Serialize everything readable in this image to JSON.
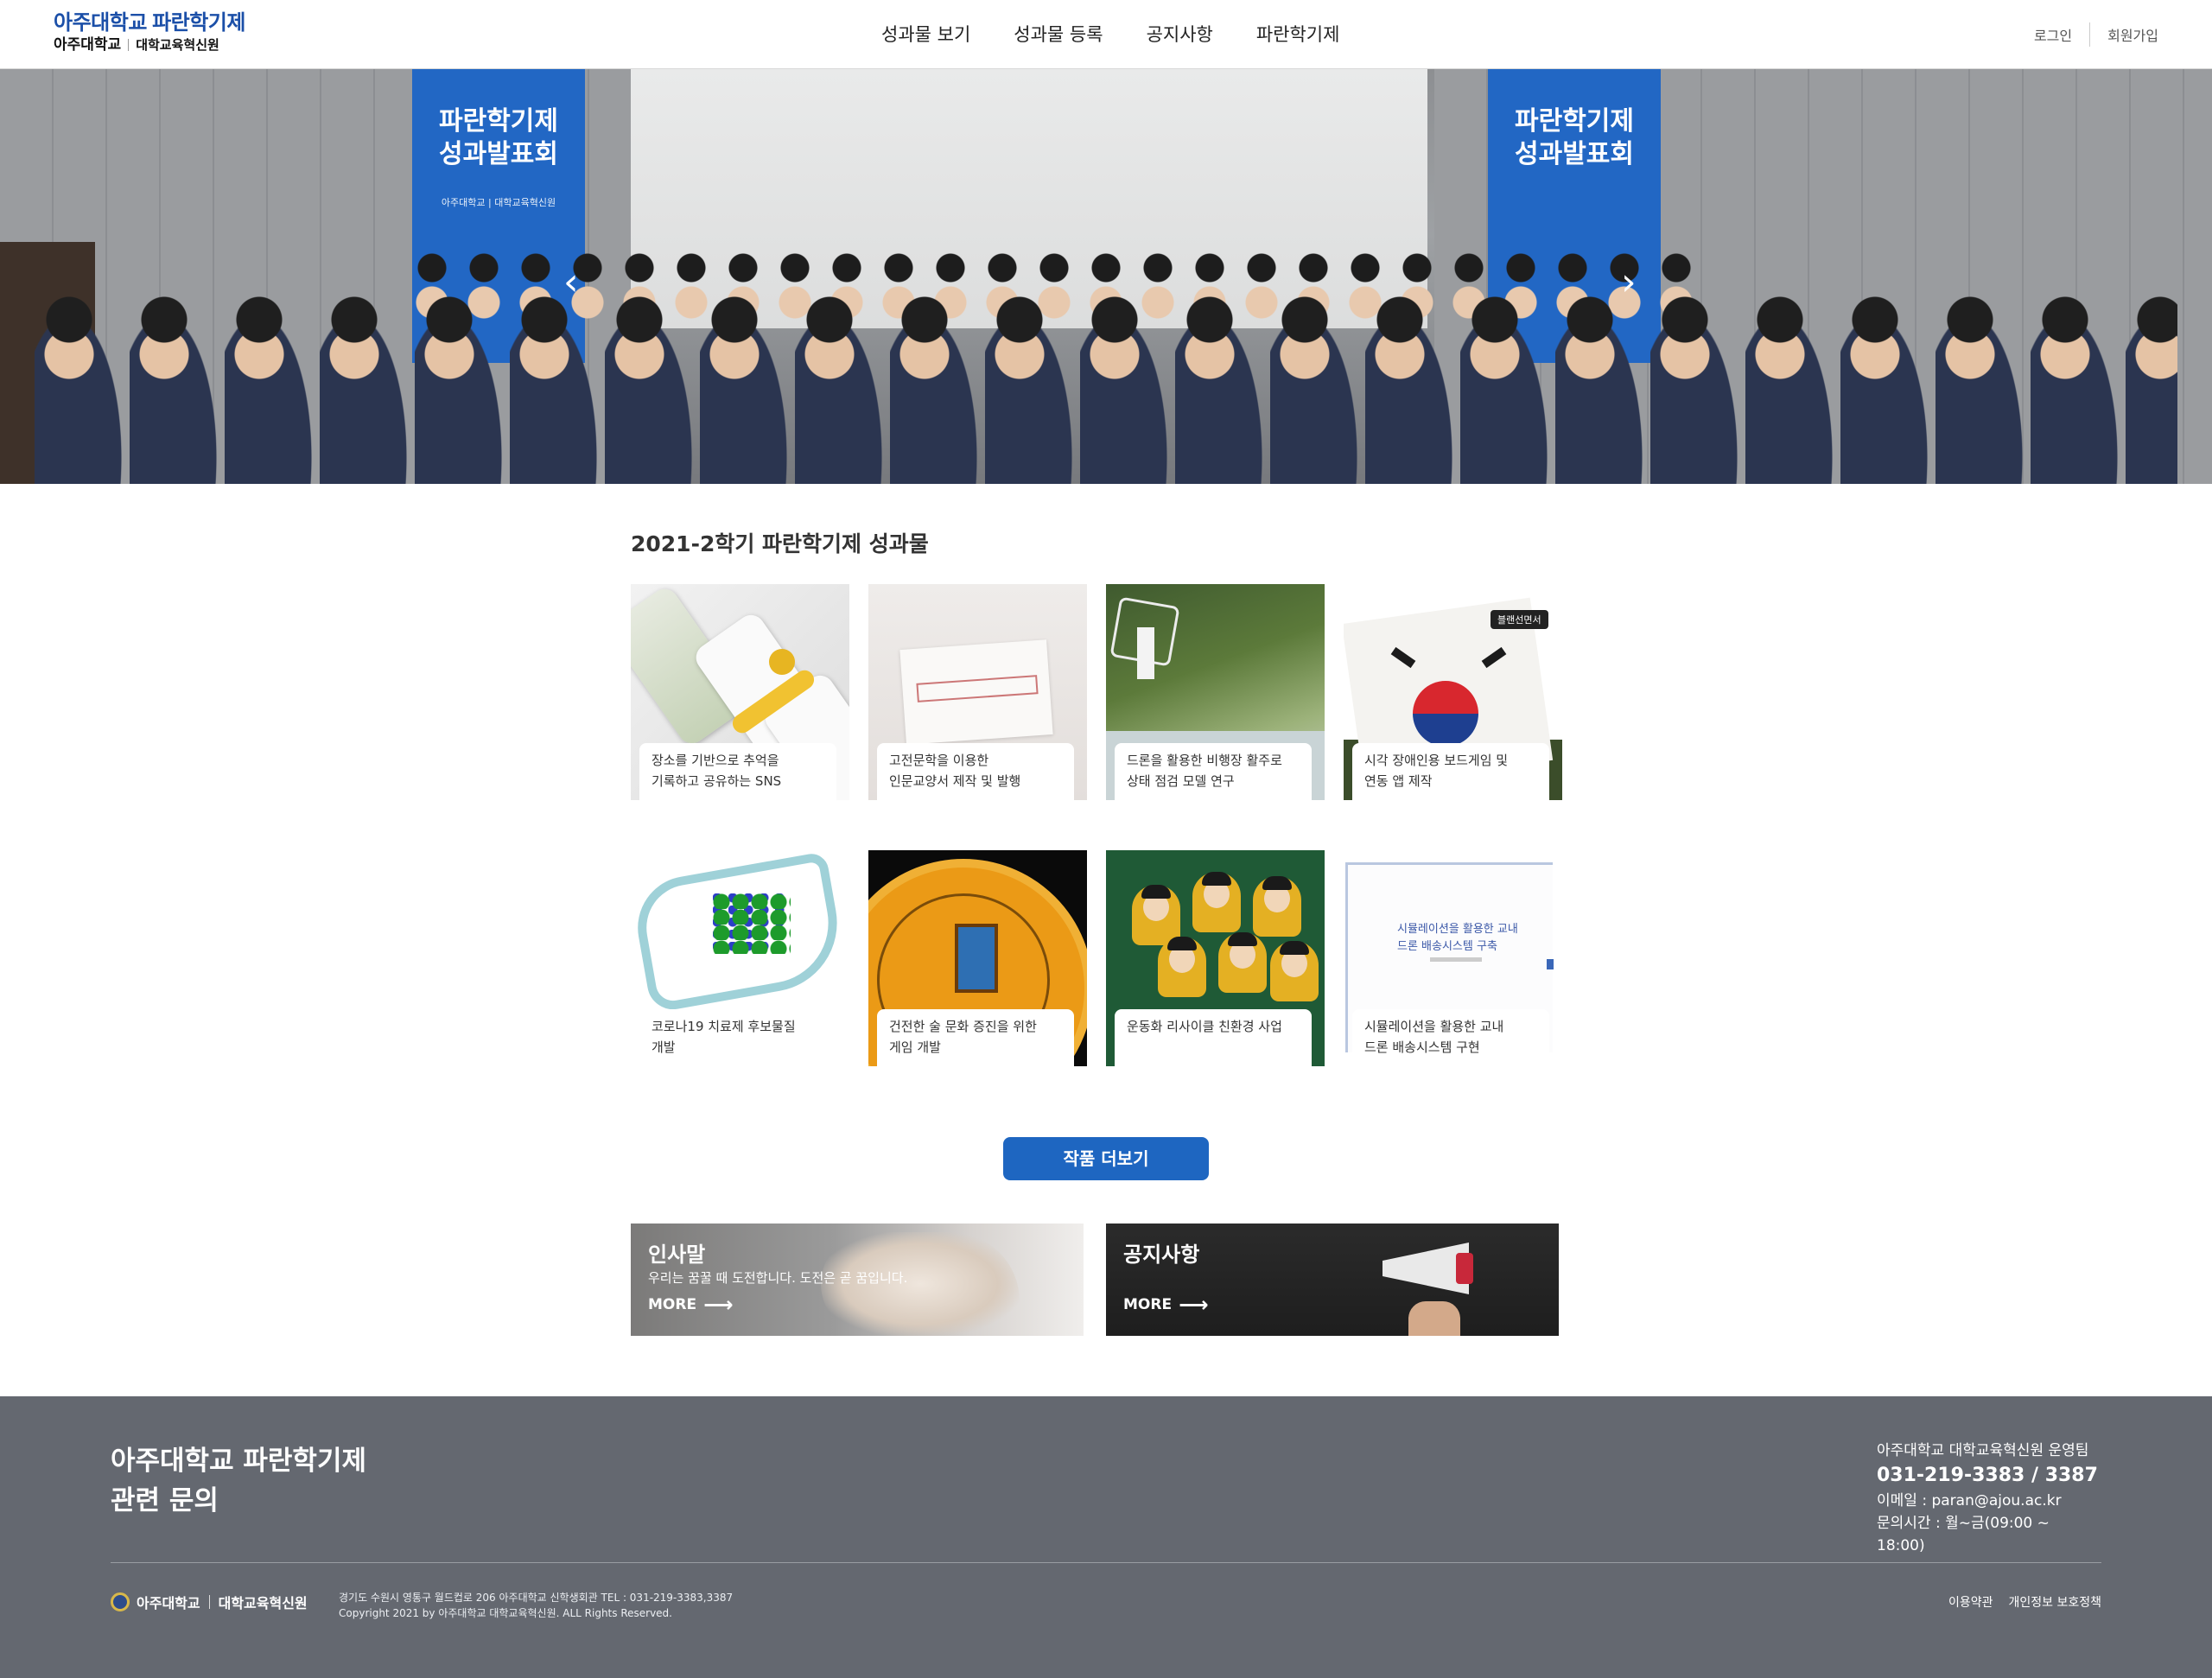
{
  "header": {
    "logo_line1": "아주대학교 파란학기제",
    "logo_line2_main": "아주대학교",
    "logo_line2_sub": "대학교육혁신원",
    "nav": [
      "성과물 보기",
      "성과물 등록",
      "공지사항",
      "파란학기제"
    ],
    "login": "로그인",
    "signup": "회원가입"
  },
  "hero": {
    "banner_text_line1": "파란학기제",
    "banner_text_line2": "성과발표회",
    "banner_left_sub": "아주대학교 | 대학교육혁신원",
    "prev_icon": "‹",
    "next_icon": "›",
    "slide_count": 4,
    "active_slide": 1
  },
  "section": {
    "title": "2021-2학기 파란학기제 성과물"
  },
  "cards": [
    {
      "line1": "장소를 기반으로 추억을",
      "line2": "기록하고 공유하는 SNS"
    },
    {
      "line1": "고전문학을 이용한",
      "line2": "인문교양서 제작 및 발행"
    },
    {
      "line1": "드론을 활용한 비행장 활주로",
      "line2": "상태 점검 모델 연구"
    },
    {
      "line1": "시각 장애인용 보드게임 및",
      "line2": "연동 앱 제작"
    },
    {
      "line1": "코로나19 치료제 후보물질",
      "line2": "개발"
    },
    {
      "line1": "건전한 술 문화 증진을 위한",
      "line2": "게임 개발"
    },
    {
      "line1": "운동화 리사이클 친환경 사업",
      "line2": ""
    },
    {
      "line1": "시뮬레이션을 활용한 교내",
      "line2": "드론 배송시스템 구현"
    }
  ],
  "card_thumb_text": {
    "badge4": "블랜선면서",
    "slide8_line1": "시뮬레이션을 활용한 교내",
    "slide8_line2": "드론 배송시스템 구축"
  },
  "more_button": "작품 더보기",
  "promos": {
    "greeting": {
      "title": "인사말",
      "desc": "우리는 꿈꿀 때 도전합니다. 도전은 곧 꿈입니다.",
      "more": "MORE"
    },
    "notice": {
      "title": "공지사항",
      "more": "MORE"
    }
  },
  "footer": {
    "title_line1": "아주대학교 파란학기제",
    "title_line2": "관련 문의",
    "team": "아주대학교 대학교육혁신원 운영팀",
    "phone": "031-219-3383 / 3387",
    "email": "이메일 : paran@ajou.ac.kr",
    "hours": "문의시간 : 월~금(09:00 ~ 18:00)",
    "logo_main": "아주대학교",
    "logo_sub": "대학교육혁신원",
    "address": "경기도 수원시 영통구 월드컵로 206 아주대학교 신학생회관 TEL : 031-219-3383,3387",
    "copyright": "Copyright 2021 by 아주대학교 대학교육혁신원. ALL Rights Reserved.",
    "terms": "이용약관",
    "privacy": "개인정보 보호정책"
  },
  "colors": {
    "accent": "#1e66c1",
    "footer_bg": "#646870",
    "logo_blue": "#1b4fa8"
  }
}
